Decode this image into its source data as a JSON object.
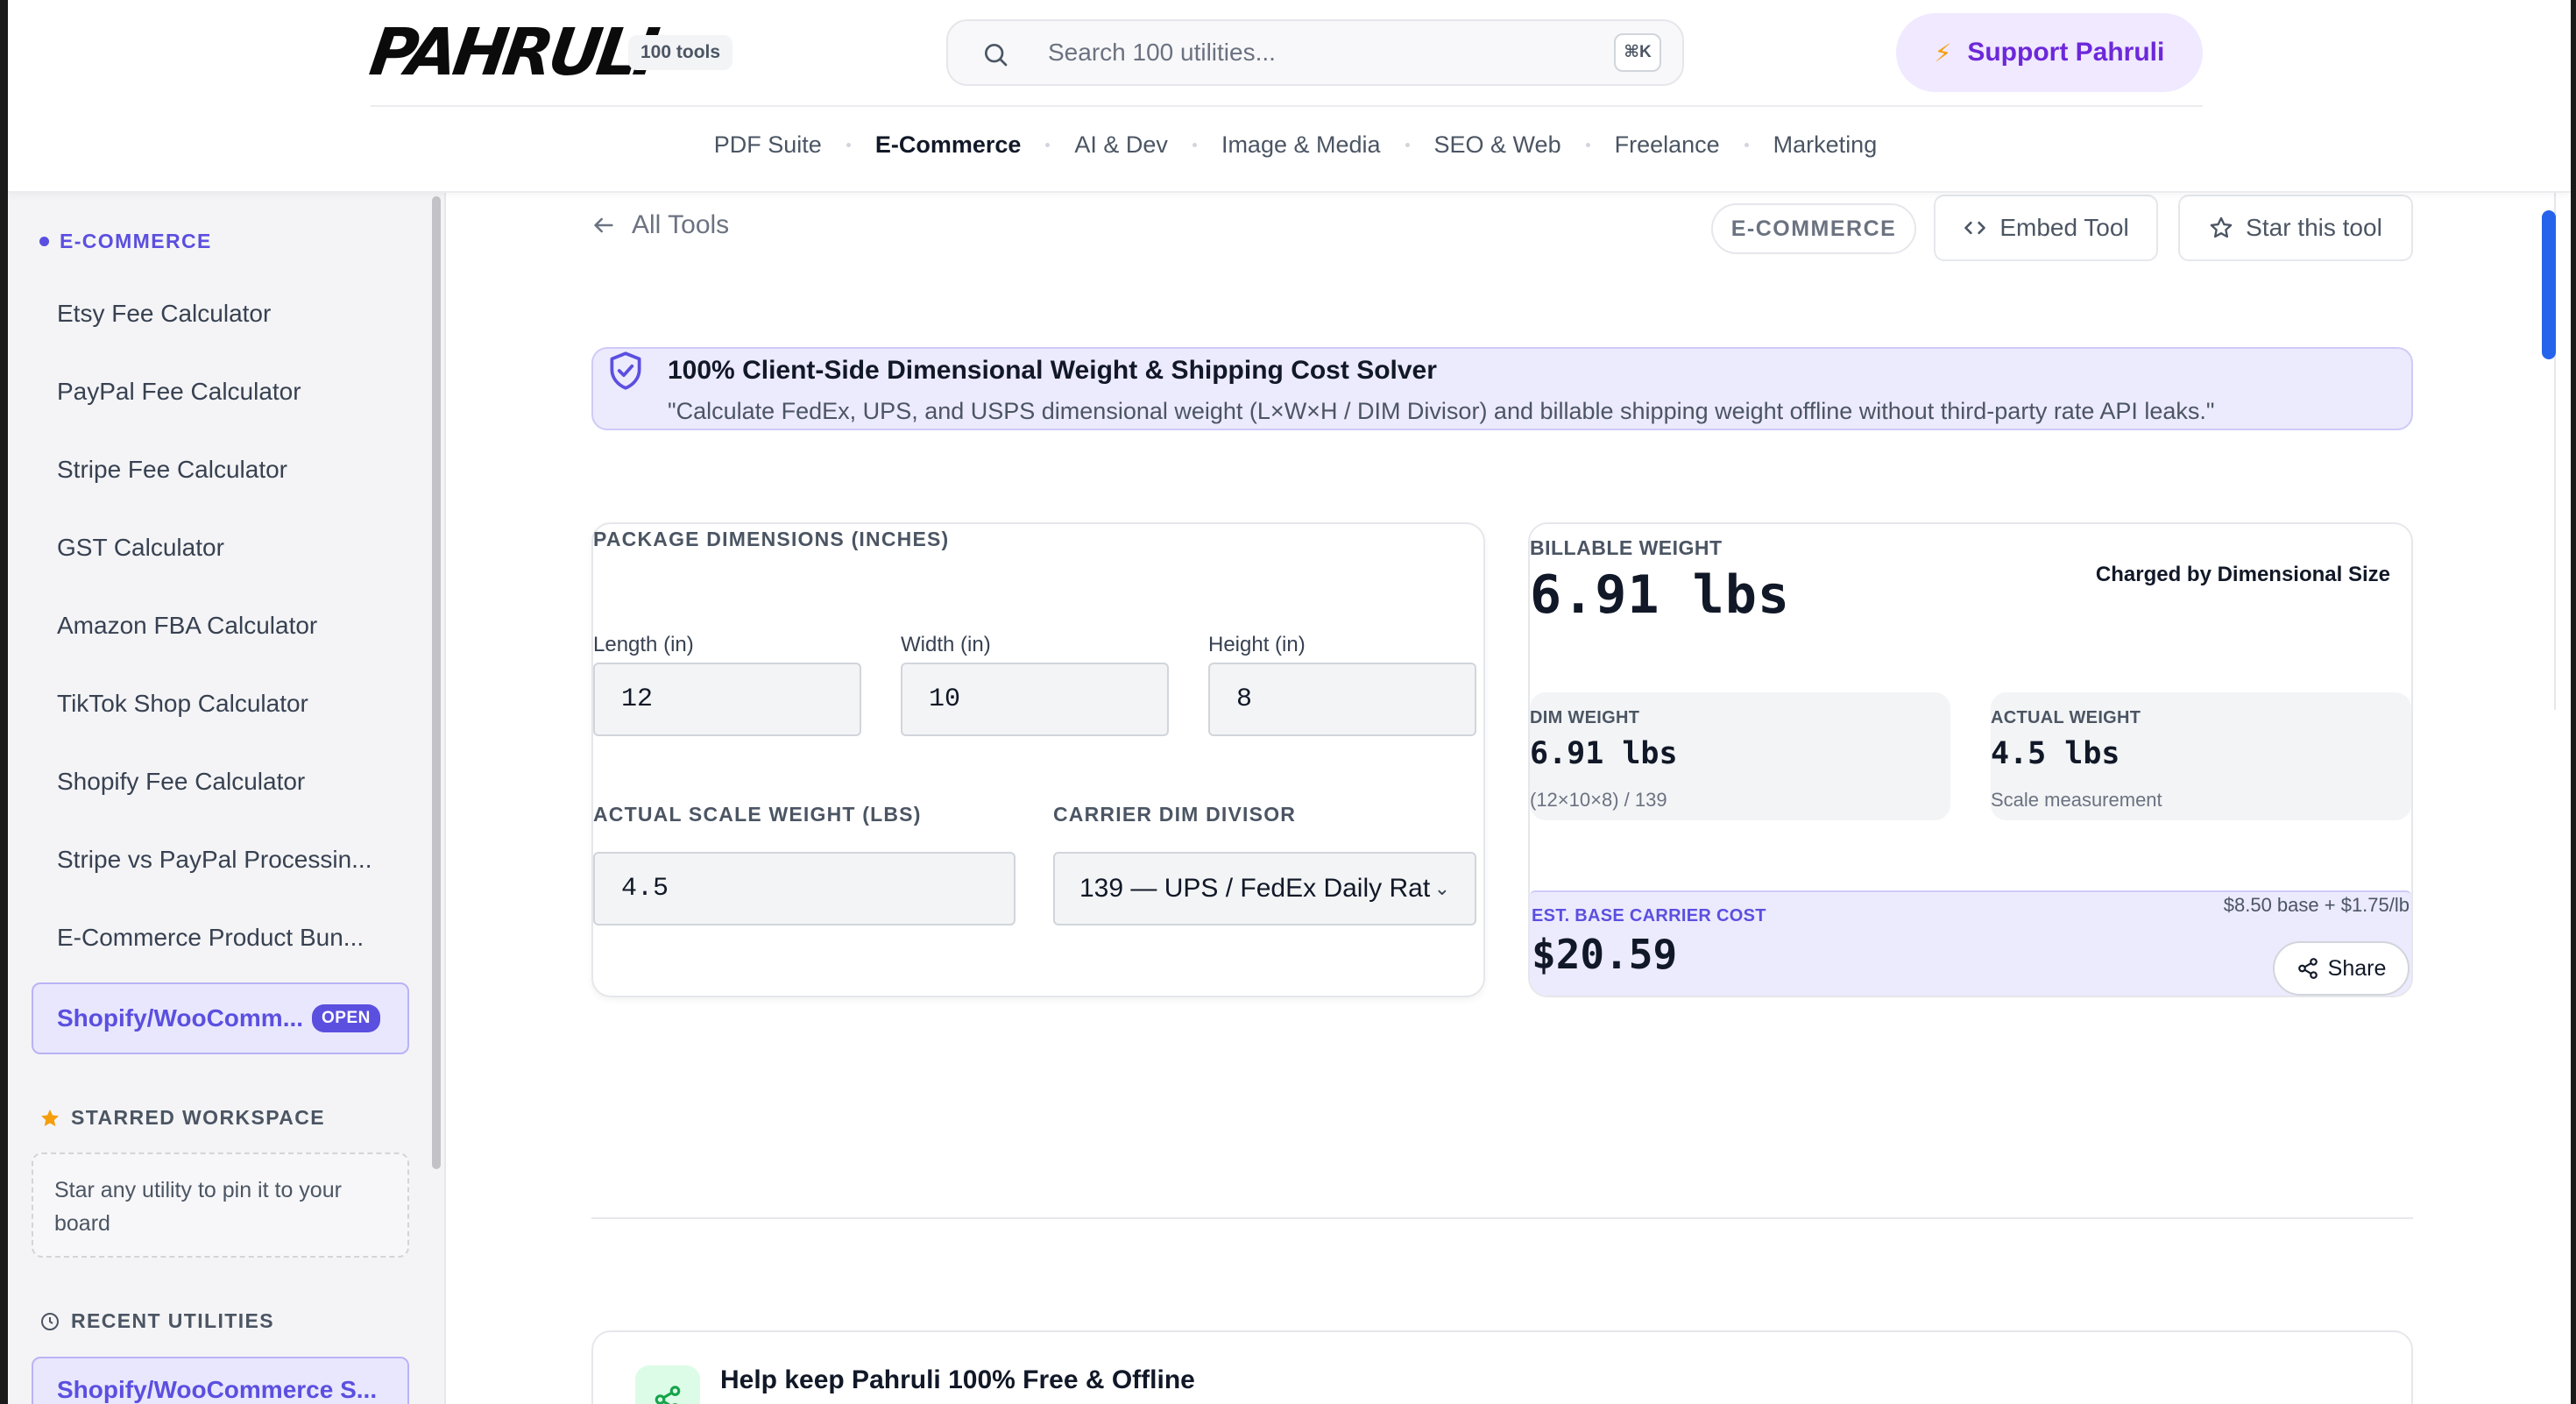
{
  "header": {
    "logo": "PAHRULI",
    "tools_badge": "100 tools",
    "search_placeholder": "Search 100 utilities...",
    "search_shortcut": "⌘K",
    "support_label": "Support Pahruli",
    "nav": [
      {
        "label": "PDF Suite",
        "active": false
      },
      {
        "label": "E-Commerce",
        "active": true
      },
      {
        "label": "AI & Dev",
        "active": false
      },
      {
        "label": "Image & Media",
        "active": false
      },
      {
        "label": "SEO & Web",
        "active": false
      },
      {
        "label": "Freelance",
        "active": false
      },
      {
        "label": "Marketing",
        "active": false
      }
    ]
  },
  "sidebar": {
    "section_title": "E-COMMERCE",
    "items": [
      "Etsy Fee Calculator",
      "PayPal Fee Calculator",
      "Stripe Fee Calculator",
      "GST Calculator",
      "Amazon FBA Calculator",
      "TikTok Shop Calculator",
      "Shopify Fee Calculator",
      "Stripe vs PayPal Processin...",
      "E-Commerce Product Bun..."
    ],
    "active_item": "Shopify/WooComm...",
    "active_badge": "OPEN",
    "starred_title": "STARRED WORKSPACE",
    "starred_empty": "Star any utility to pin it to your board",
    "recent_title": "RECENT UTILITIES",
    "recent_items": [
      "Shopify/WooCommerce S..."
    ]
  },
  "toolbar": {
    "back_label": "All Tools",
    "category_pill": "E-COMMERCE",
    "embed_label": "Embed Tool",
    "star_label": "Star this tool"
  },
  "banner": {
    "title": "100% Client-Side Dimensional Weight & Shipping Cost Solver",
    "subtitle": "\"Calculate FedEx, UPS, and USPS dimensional weight (L×W×H / DIM Divisor) and billable shipping weight offline without third-party rate API leaks.\""
  },
  "form": {
    "section_title": "PACKAGE DIMENSIONS (INCHES)",
    "length_label": "Length (in)",
    "length_value": "12",
    "width_label": "Width (in)",
    "width_value": "10",
    "height_label": "Height (in)",
    "height_value": "8",
    "weight_label": "ACTUAL SCALE WEIGHT (LBS)",
    "weight_value": "4.5",
    "divisor_label": "CARRIER DIM DIVISOR",
    "divisor_value": "139 — UPS / FedEx Daily Rat"
  },
  "results": {
    "billable_label": "BILLABLE WEIGHT",
    "billable_value": "6.91 lbs",
    "charged_by": "Charged by Dimensional Size",
    "dim_label": "DIM WEIGHT",
    "dim_value": "6.91 lbs",
    "dim_formula": "(12×10×8) / 139",
    "actual_label": "ACTUAL WEIGHT",
    "actual_value": "4.5 lbs",
    "actual_sub": "Scale measurement",
    "cost_label": "EST. BASE CARRIER COST",
    "cost_value": "$20.59",
    "cost_base": "$8.50 base + $1.75/lb",
    "share_label": "Share"
  },
  "help": {
    "title": "Help keep Pahruli 100% Free & Offline"
  },
  "colors": {
    "accent": "#5b4fe0",
    "support_bg": "#f0e9ff",
    "banner_bg": "#eceafd",
    "scroll_thumb": "#2563eb"
  }
}
